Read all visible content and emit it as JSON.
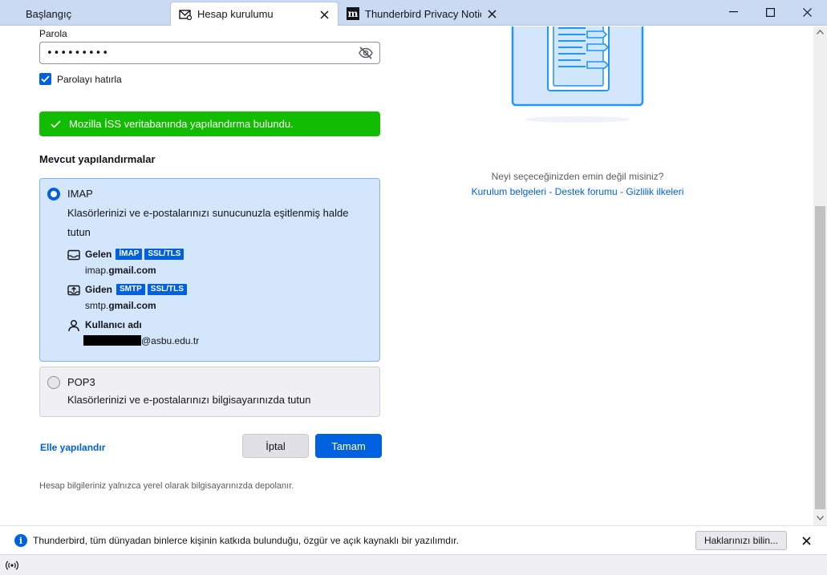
{
  "tabs": [
    {
      "label": "Başlangıç",
      "icon": "home-tab-icon",
      "active": false
    },
    {
      "label": "Hesap kurulumu",
      "icon": "mail-setup-icon",
      "active": true
    },
    {
      "label": "Thunderbird Privacy Notice",
      "icon": "mozilla-m-icon",
      "active": false
    }
  ],
  "form": {
    "password_label": "Parola",
    "password_value": "•••••••••",
    "remember_label": "Parolayı hatırla",
    "remember_checked": true,
    "success_message": "Mozilla İSS veritabanında yapılandırma bulundu."
  },
  "configs": {
    "heading": "Mevcut yapılandırmalar",
    "imap": {
      "title": "IMAP",
      "desc_line1": "Klasörlerinizi ve e-postalarınızı sunucunuzla eşitlenmiş halde",
      "desc_line2": "tutun",
      "incoming_label": "Gelen",
      "incoming_badges": [
        "İMAP",
        "SSL/TLS"
      ],
      "incoming_host_prefix": "imap.",
      "incoming_host_domain": "gmail.com",
      "outgoing_label": "Giden",
      "outgoing_badges": [
        "SMTP",
        "SSL/TLS"
      ],
      "outgoing_host_prefix": "smtp.",
      "outgoing_host_domain": "gmail.com",
      "username_label": "Kullanıcı adı",
      "username_suffix": "@asbu.edu.tr",
      "selected": true
    },
    "pop3": {
      "title": "POP3",
      "desc": "Klasörlerinizi ve e-postalarınızı bilgisayarınızda tutun",
      "selected": false
    }
  },
  "actions": {
    "manual_label": "Elle yapılandır",
    "cancel_label": "İptal",
    "ok_label": "Tamam"
  },
  "footnote": "Hesap bilgileriniz yalnızca yerel olarak bilgisayarınızda depolanır.",
  "help": {
    "question": "Neyi seçeceğinizden emin değil misiniz?",
    "link_docs": "Kurulum belgeleri",
    "link_forum": "Destek forumu",
    "link_privacy": "Gizlilik ilkeleri",
    "separator": " - "
  },
  "notification": {
    "text": "Thunderbird, tüm dünyadan binlerce kişinin katkıda bulunduğu, özgür ve açık kaynaklı bir yazılımdır.",
    "button_label": "Haklarınızı bilin...",
    "info_glyph": "i"
  },
  "colors": {
    "accent": "#0061e0",
    "success": "#12bc00",
    "selected_card": "#d3e6fb",
    "titlebar": "#c9daf2"
  }
}
